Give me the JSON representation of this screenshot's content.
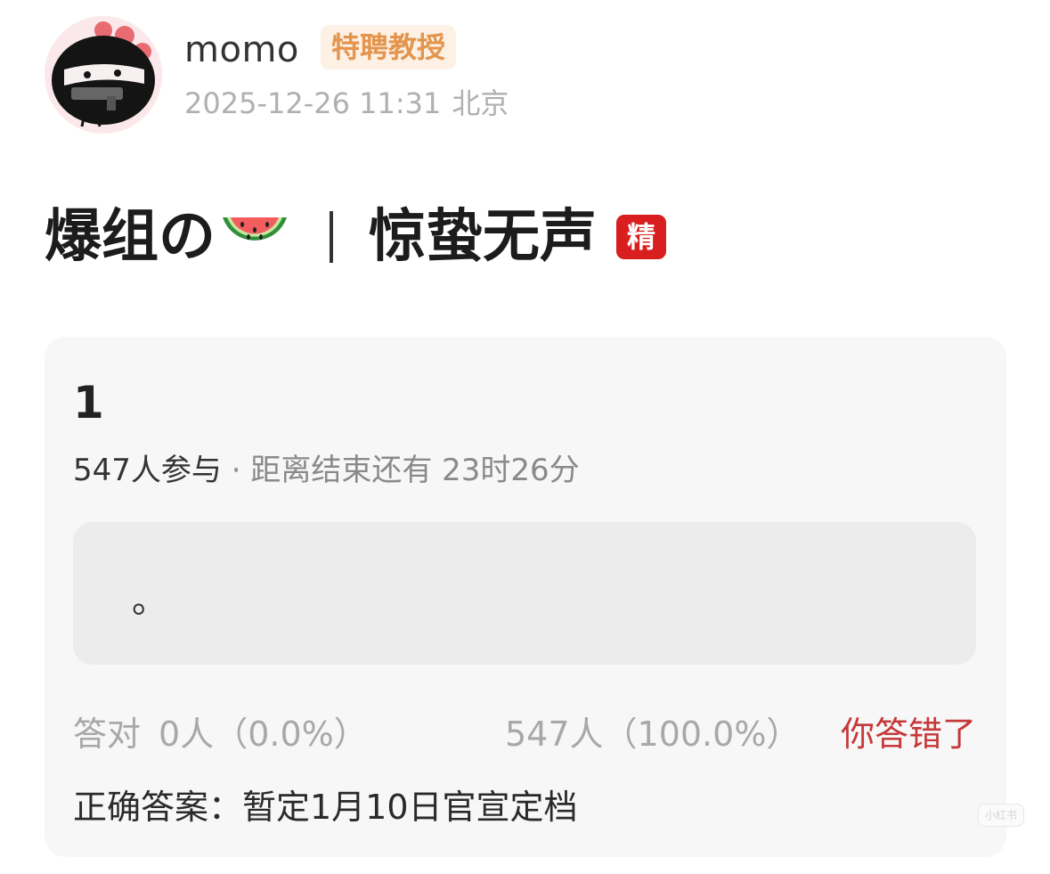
{
  "header": {
    "username": "momo",
    "badge": "特聘教授",
    "timestamp": "2025-12-26 11:31",
    "location": "北京"
  },
  "title": {
    "part1": "爆组の",
    "emoji": "watermelon-icon",
    "separator": "|",
    "part2": "惊蛰无声",
    "tag": "精"
  },
  "quiz": {
    "number": "1",
    "participants": "547人参与",
    "time_left": " · 距离结束还有 23时26分",
    "option_text": "。",
    "correct_label": "答对",
    "correct_count": "0人（0.0%）",
    "wrong_count": "547人（100.0%）",
    "result_status": "你答错了",
    "answer": "正确答案：暂定1月10日官宣定档"
  },
  "watermark": "小红书",
  "colors": {
    "badge_bg": "#fdf0e4",
    "badge_text": "#e3954e",
    "tag_red": "#d81e1e",
    "wrong_red": "#c6383a",
    "card_bg": "#f7f7f7",
    "option_bg": "#ececec"
  }
}
